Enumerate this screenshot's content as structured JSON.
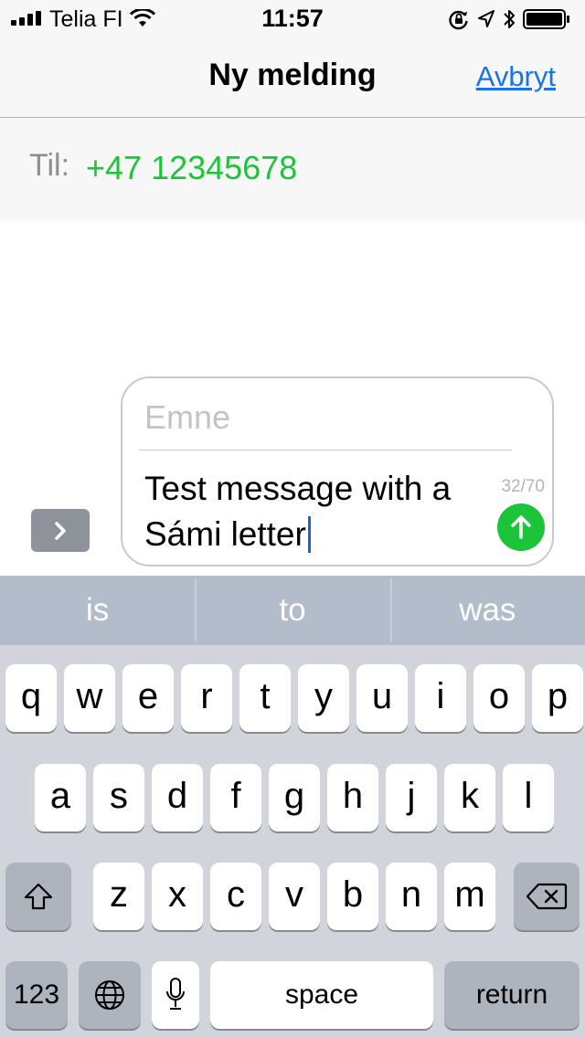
{
  "status_bar": {
    "carrier": "Telia FI",
    "time": "11:57"
  },
  "nav": {
    "title": "Ny melding",
    "cancel_label": "Avbryt"
  },
  "recipient": {
    "label": "Til:",
    "value": "+47 12345678"
  },
  "composer": {
    "subject_placeholder": "Emne",
    "message_line1": "Test message with a",
    "message_line2": "Sámi letter",
    "char_count": "32/70"
  },
  "keyboard": {
    "suggestions": [
      "is",
      "to",
      "was"
    ],
    "row1": [
      "q",
      "w",
      "e",
      "r",
      "t",
      "y",
      "u",
      "i",
      "o",
      "p"
    ],
    "row2": [
      "a",
      "s",
      "d",
      "f",
      "g",
      "h",
      "j",
      "k",
      "l"
    ],
    "row3": [
      "z",
      "x",
      "c",
      "v",
      "b",
      "n",
      "m"
    ],
    "numbers_label": "123",
    "space_label": "space",
    "return_label": "return"
  },
  "colors": {
    "accent_green": "#1cc43a",
    "link_blue": "#1a73e8",
    "keyboard_bg": "#d1d5db",
    "suggestion_bar": "#b3bccb"
  },
  "icons": {
    "signal": "cellular-signal-icon",
    "wifi": "wifi-icon",
    "rotation_lock": "rotation-lock-icon",
    "location": "location-arrow-icon",
    "bluetooth": "bluetooth-icon",
    "battery": "battery-icon",
    "expand": "chevron-right-icon",
    "send": "arrow-up-icon",
    "shift": "shift-icon",
    "backspace": "backspace-icon",
    "globe": "globe-icon",
    "microphone": "microphone-icon"
  }
}
